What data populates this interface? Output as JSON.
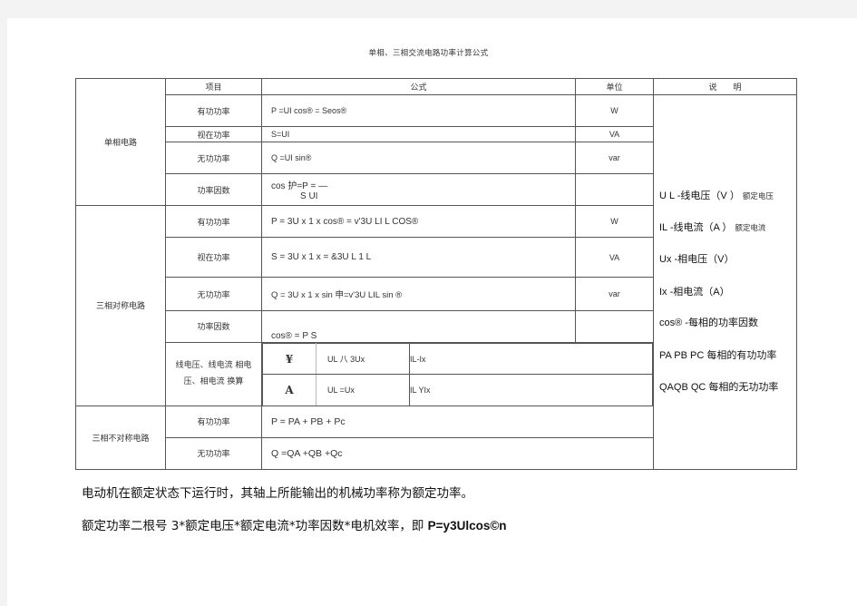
{
  "document": {
    "title": "单相、三相交流电路功率计算公式",
    "headers": {
      "col1": "",
      "item": "项目",
      "formula": "公式",
      "unit": "单位",
      "note": "说　　明"
    },
    "groups": [
      {
        "category": "单相电路",
        "rows": [
          {
            "item": "有功功率",
            "formula": "P =UI cos® = Seos®",
            "unit": "W"
          },
          {
            "item": "视在功率",
            "formula": "S=UI",
            "unit": "VA"
          },
          {
            "item": "无功功率",
            "formula": "Q =UI sin®",
            "unit": "var"
          },
          {
            "item": "功率因数",
            "formula": "cos 护=P = —",
            "formula_sub": "S UI",
            "unit": ""
          }
        ]
      },
      {
        "category": "三相对称电路",
        "rows": [
          {
            "item": "有功功率",
            "formula": "P = 3U x 1 x cos® = v'3U LI L COS®",
            "unit": "W"
          },
          {
            "item": "视在功率",
            "formula": "S = 3U x 1 x = &3U L 1 L",
            "unit": "VA"
          },
          {
            "item": "无功功率",
            "formula": "Q = 3U x 1 x sin 申=v'3U LIL sin ®",
            "unit": "var"
          },
          {
            "item": "功率因数",
            "formula": "cos® = P S",
            "unit": ""
          }
        ],
        "conversion": {
          "label_line1": "线电压、线电流 相电",
          "label_line2": "压、相电流 换算",
          "rows": [
            {
              "symbol": "¥",
              "voltage": "UL 八 3Ux",
              "current": "IL-Ix"
            },
            {
              "symbol": "A",
              "voltage": "UL =Ux",
              "current": "IL YIx"
            }
          ]
        }
      },
      {
        "category": "三相不对称电路",
        "rows": [
          {
            "item": "有功功率",
            "formula": "P = PA + PB + Pc"
          },
          {
            "item": "无功功率",
            "formula": "Q =QA +QB +Qc"
          }
        ]
      }
    ],
    "notes": [
      {
        "main": "U L -线电压（V ）",
        "small": "额定电压"
      },
      {
        "main": "IL -线电流（A ）",
        "small": "额定电流"
      },
      {
        "main": "Ux -相电压（V）",
        "small": ""
      },
      {
        "main": "Ix -相电流（A）",
        "small": ""
      },
      {
        "main": "cos®  -每相的功率因数",
        "small": ""
      },
      {
        "main": "PA PB PC 每相的有功功率",
        "small": ""
      },
      {
        "main": "QAQB QC 每相的无功功率",
        "small": ""
      }
    ],
    "paragraphs": [
      {
        "text": "电动机在额定状态下运行时，其轴上所能输出的机械功率称为额定功率。",
        "bold": ""
      },
      {
        "text": "额定功率二根号 3*额定电压*额定电流*功率因数*电机效率，即 ",
        "bold": "P=y3Ulcos©n"
      }
    ]
  }
}
